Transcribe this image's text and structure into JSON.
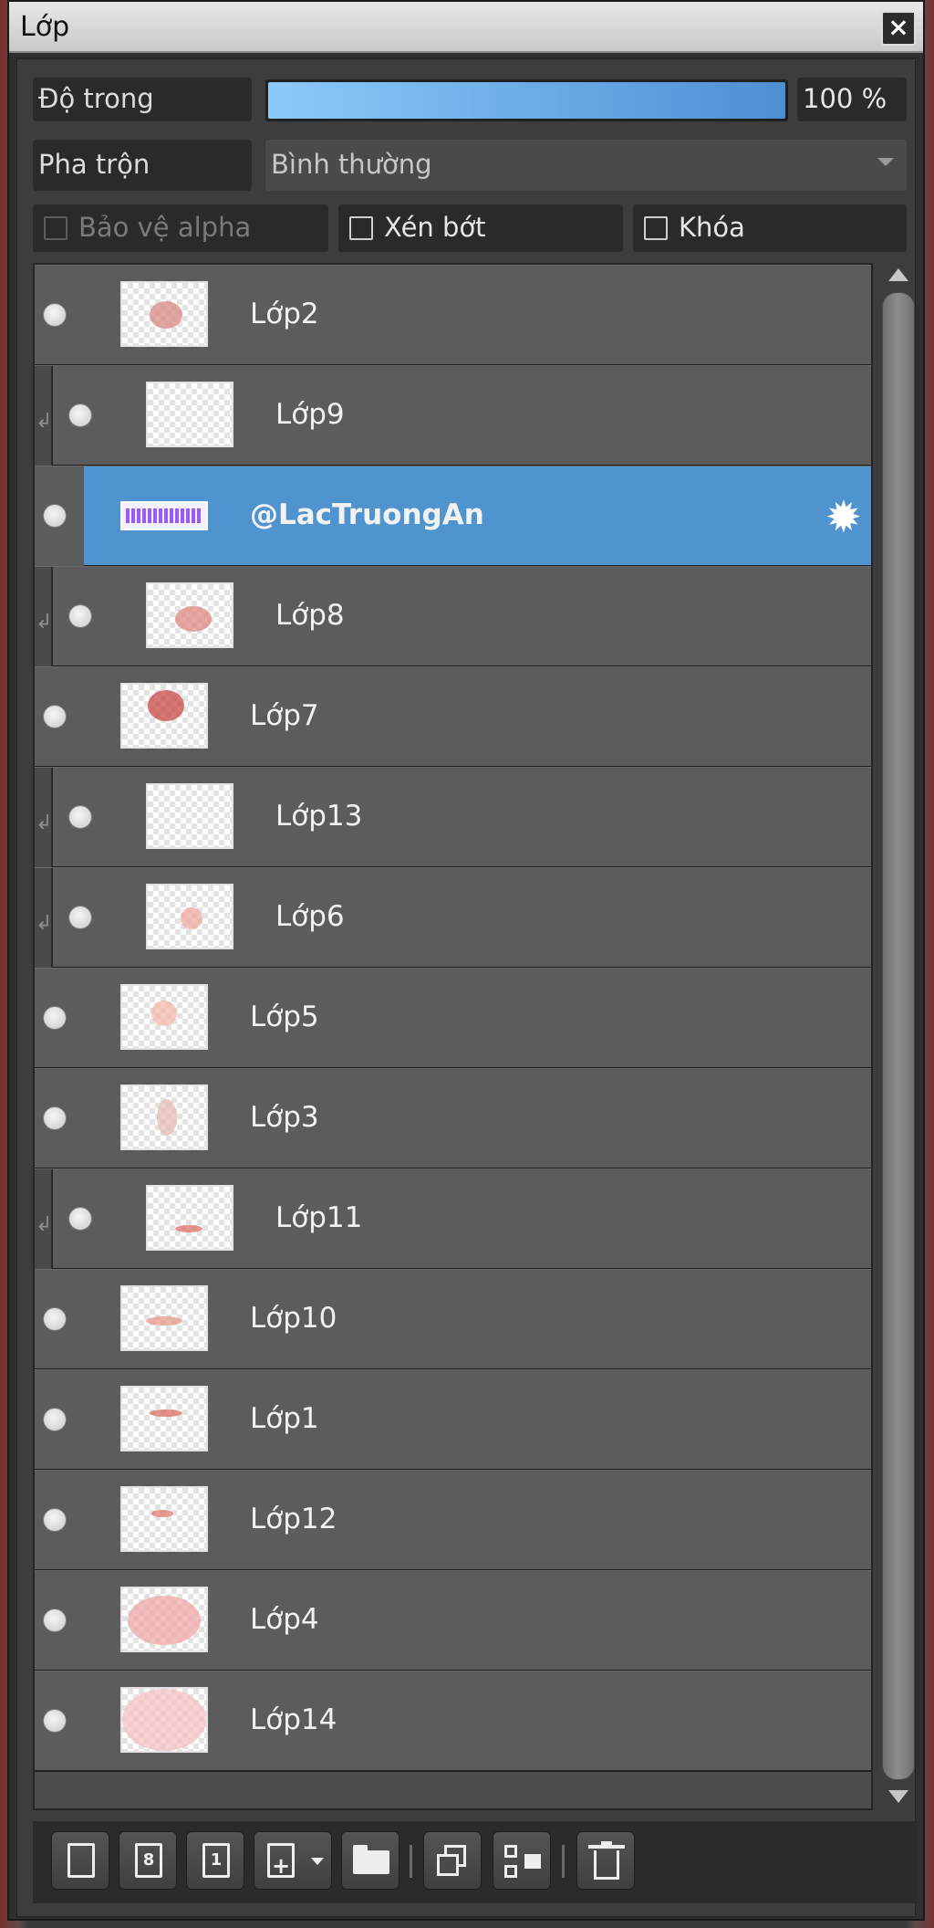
{
  "window": {
    "title": "Lớp",
    "close_glyph": "×"
  },
  "opacity": {
    "label": "Độ trong",
    "value_text": "100 %",
    "level": 1.0
  },
  "blend": {
    "label": "Pha trộn",
    "value": "Bình thường"
  },
  "options": [
    {
      "label": "Bảo vệ alpha",
      "checked": false,
      "disabled": true
    },
    {
      "label": "Xén bớt",
      "checked": false,
      "disabled": false
    },
    {
      "label": "Khóa",
      "checked": false,
      "disabled": false
    }
  ],
  "layers": [
    {
      "name": "Lớp2",
      "clipped": false,
      "selected": false
    },
    {
      "name": "Lớp9",
      "clipped": true,
      "selected": false
    },
    {
      "name": "@LacTruongAn",
      "clipped": false,
      "selected": true
    },
    {
      "name": "Lớp8",
      "clipped": true,
      "selected": false
    },
    {
      "name": "Lớp7",
      "clipped": false,
      "selected": false
    },
    {
      "name": "Lớp13",
      "clipped": true,
      "selected": false
    },
    {
      "name": "Lớp6",
      "clipped": true,
      "selected": false
    },
    {
      "name": "Lớp5",
      "clipped": false,
      "selected": false
    },
    {
      "name": "Lớp3",
      "clipped": false,
      "selected": false
    },
    {
      "name": "Lớp11",
      "clipped": true,
      "selected": false
    },
    {
      "name": "Lớp10",
      "clipped": false,
      "selected": false
    },
    {
      "name": "Lớp1",
      "clipped": false,
      "selected": false
    },
    {
      "name": "Lớp12",
      "clipped": false,
      "selected": false
    },
    {
      "name": "Lớp4",
      "clipped": false,
      "selected": false
    },
    {
      "name": "Lớp14",
      "clipped": false,
      "selected": false
    }
  ],
  "toolbar": {
    "new_layer_8bit_glyph": "8",
    "new_layer_1bit_glyph": "1",
    "add_glyph": "+",
    "icons": [
      "new-layer-icon",
      "new-8bit-layer-icon",
      "new-1bit-layer-icon",
      "add-layer-menu-icon",
      "folder-icon",
      "duplicate-layer-icon",
      "merge-layer-icon",
      "trash-icon"
    ]
  },
  "colors": {
    "selected": "#5094cf",
    "row": "#5c5c5c",
    "opacity_bar": "#6fb3ee"
  }
}
